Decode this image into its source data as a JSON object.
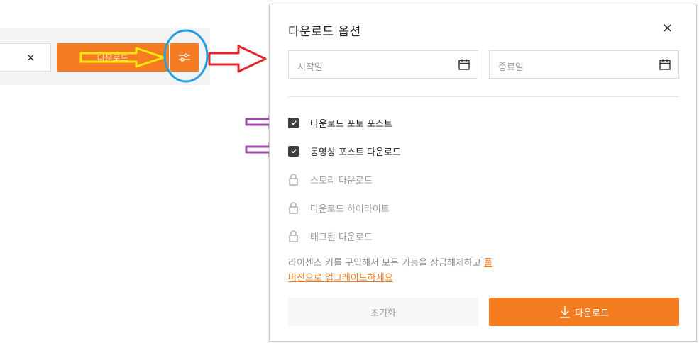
{
  "toolbar": {
    "clear_icon": "×",
    "download_label": "다운로드",
    "options_icon": "sliders-icon"
  },
  "modal": {
    "title": "다운로드 옵션",
    "close_icon": "×",
    "start_date_placeholder": "시작일",
    "end_date_placeholder": "종료일",
    "options": [
      {
        "label": "다운로드 포토 포스트",
        "checked": true,
        "locked": false
      },
      {
        "label": "동영상 포스트 다운로드",
        "checked": true,
        "locked": false
      },
      {
        "label": "스토리 다운로드",
        "checked": false,
        "locked": true
      },
      {
        "label": "다운로드 하이라이트",
        "checked": false,
        "locked": true
      },
      {
        "label": "태그된 다운로드",
        "checked": false,
        "locked": true
      }
    ],
    "note_text": "라이센스 키를 구입해서 모든 기능을 잠금해제하고 ",
    "note_link_part1": "풀",
    "note_link_part2": "버전으로 업그레이드하세요",
    "reset_label": "초기화",
    "download_label": "다운로드"
  },
  "colors": {
    "accent": "#f57c21",
    "annotation_yellow": "#f5e90c",
    "annotation_red": "#e3262c",
    "annotation_blue": "#1f9fe0",
    "annotation_purple": "#a24aa8"
  }
}
